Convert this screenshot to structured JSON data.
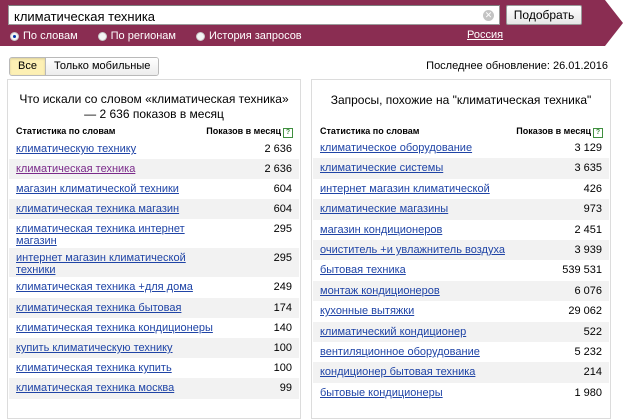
{
  "search": {
    "query": "климатическая техника",
    "button_label": "Подобрать",
    "radio_options": [
      {
        "label": "По словам",
        "checked": true
      },
      {
        "label": "По регионам",
        "checked": false
      },
      {
        "label": "История запросов",
        "checked": false
      }
    ],
    "region": "Россия"
  },
  "filters": {
    "all_label": "Все",
    "mobile_label": "Только мобильные"
  },
  "last_update": "Последнее обновление: 26.01.2016",
  "left_panel": {
    "title": "Что искали со словом «климатическая техника» — 2 636 показов в месяц",
    "col_words": "Статистика по словам",
    "col_count": "Показов в месяц",
    "rows": [
      {
        "text": "климатическую технику",
        "count": "2 636"
      },
      {
        "text": "климатическая техника",
        "count": "2 636",
        "visited": true
      },
      {
        "text": "магазин климатической техники",
        "count": "604"
      },
      {
        "text": "климатическая техника магазин",
        "count": "604"
      },
      {
        "text": "климатическая техника интернет магазин",
        "count": "295"
      },
      {
        "text": "интернет магазин климатической техники",
        "count": "295"
      },
      {
        "text": "климатическая техника +для дома",
        "count": "249"
      },
      {
        "text": "климатическая техника бытовая",
        "count": "174"
      },
      {
        "text": "климатическая техника кондиционеры",
        "count": "140"
      },
      {
        "text": "купить климатическую технику",
        "count": "100"
      },
      {
        "text": "климатическая техника купить",
        "count": "100"
      },
      {
        "text": "климатическая техника москва",
        "count": "99"
      }
    ]
  },
  "right_panel": {
    "title": "Запросы, похожие на \"климатическая техника\"",
    "col_words": "Статистика по словам",
    "col_count": "Показов в месяц",
    "rows": [
      {
        "text": "климатическое оборудование",
        "count": "3 129"
      },
      {
        "text": "климатические системы",
        "count": "3 635"
      },
      {
        "text": "интернет магазин климатической",
        "count": "426"
      },
      {
        "text": "климатические магазины",
        "count": "973"
      },
      {
        "text": "магазин кондиционеров",
        "count": "2 451"
      },
      {
        "text": "очиститель +и увлажнитель воздуха",
        "count": "3 939"
      },
      {
        "text": "бытовая техника",
        "count": "539 531"
      },
      {
        "text": "монтаж кондиционеров",
        "count": "6 076"
      },
      {
        "text": "кухонные вытяжки",
        "count": "29 062"
      },
      {
        "text": "климатический кондиционер",
        "count": "522"
      },
      {
        "text": "вентиляционное оборудование",
        "count": "5 232"
      },
      {
        "text": "кондиционер бытовая техника",
        "count": "214"
      },
      {
        "text": "бытовые кондиционеры",
        "count": "1 980"
      }
    ]
  }
}
